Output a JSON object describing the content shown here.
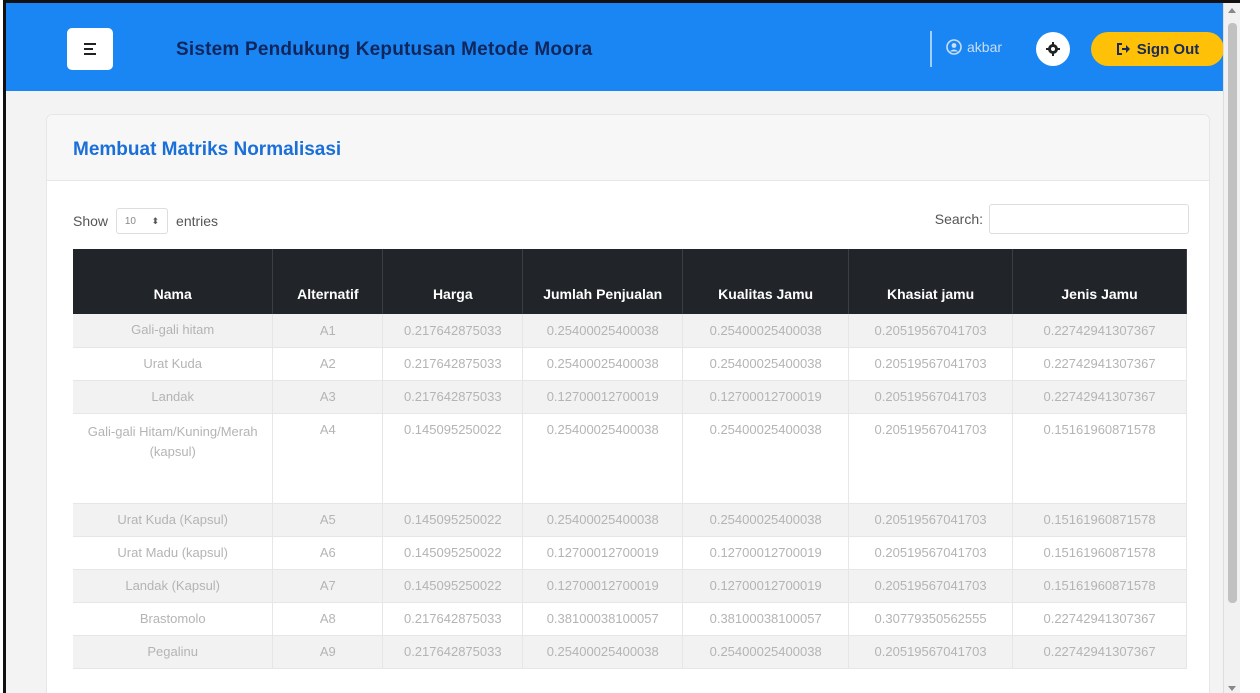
{
  "header": {
    "title": "Sistem Pendukung Keputusan Metode Moora",
    "user_name": "akbar",
    "signout_label": "Sign Out"
  },
  "card": {
    "title": "Membuat Matriks Normalisasi",
    "show_label": "Show",
    "entries_value": "10",
    "entries_label": "entries",
    "search_label": "Search:"
  },
  "table": {
    "columns": [
      "Nama",
      "Alternatif",
      "Harga",
      "Jumlah Penjualan",
      "Kualitas Jamu",
      "Khasiat jamu",
      "Jenis Jamu"
    ],
    "rows": [
      [
        "Gali-gali hitam",
        "A1",
        "0.2176428750​33",
        "0.25400025400038",
        "0.25400025400038",
        "0.20519567041703",
        "0.22742941307367"
      ],
      [
        "Urat Kuda",
        "A2",
        "0.217642875033",
        "0.25400025400038",
        "0.25400025400038",
        "0.20519567041703",
        "0.22742941307367"
      ],
      [
        "Landak",
        "A3",
        "0.217642875033",
        "0.12700012700019",
        "0.12700012700019",
        "0.20519567041703",
        "0.22742941307367"
      ],
      [
        "Gali-gali Hitam/Kuning/Merah (kapsul)",
        "A4",
        "0.145095250022",
        "0.25400025400038",
        "0.25400025400038",
        "0.20519567041703",
        "0.15161960871578"
      ],
      [
        "Urat Kuda (Kapsul)",
        "A5",
        "0.145095250022",
        "0.25400025400038",
        "0.25400025400038",
        "0.20519567041703",
        "0.15161960871578"
      ],
      [
        "Urat Madu (kapsul)",
        "A6",
        "0.145095250022",
        "0.12700012700019",
        "0.12700012700019",
        "0.20519567041703",
        "0.15161960871578"
      ],
      [
        "Landak (Kapsul)",
        "A7",
        "0.145095250022",
        "0.12700012700019",
        "0.12700012700019",
        "0.20519567041703",
        "0.15161960871578"
      ],
      [
        "Brastomolo",
        "A8",
        "0.217642875033",
        "0.38100038100057",
        "0.38100038100057",
        "0.30779350562555",
        "0.22742941307367"
      ],
      [
        "Pegalinu",
        "A9",
        "0.217642875033",
        "0.25400025400038",
        "0.25400025400038",
        "0.20519567041703",
        "0.22742941307367"
      ]
    ]
  },
  "icons": {
    "menu": "menu-icon",
    "user": "user-icon",
    "gear": "gear-icon",
    "signout": "sign-out-icon"
  },
  "colors": {
    "topbar": "#1a86f3",
    "title_text": "#10265c",
    "card_title": "#1a6fd8",
    "signout_bg": "#ffc107",
    "table_header": "#212529"
  }
}
